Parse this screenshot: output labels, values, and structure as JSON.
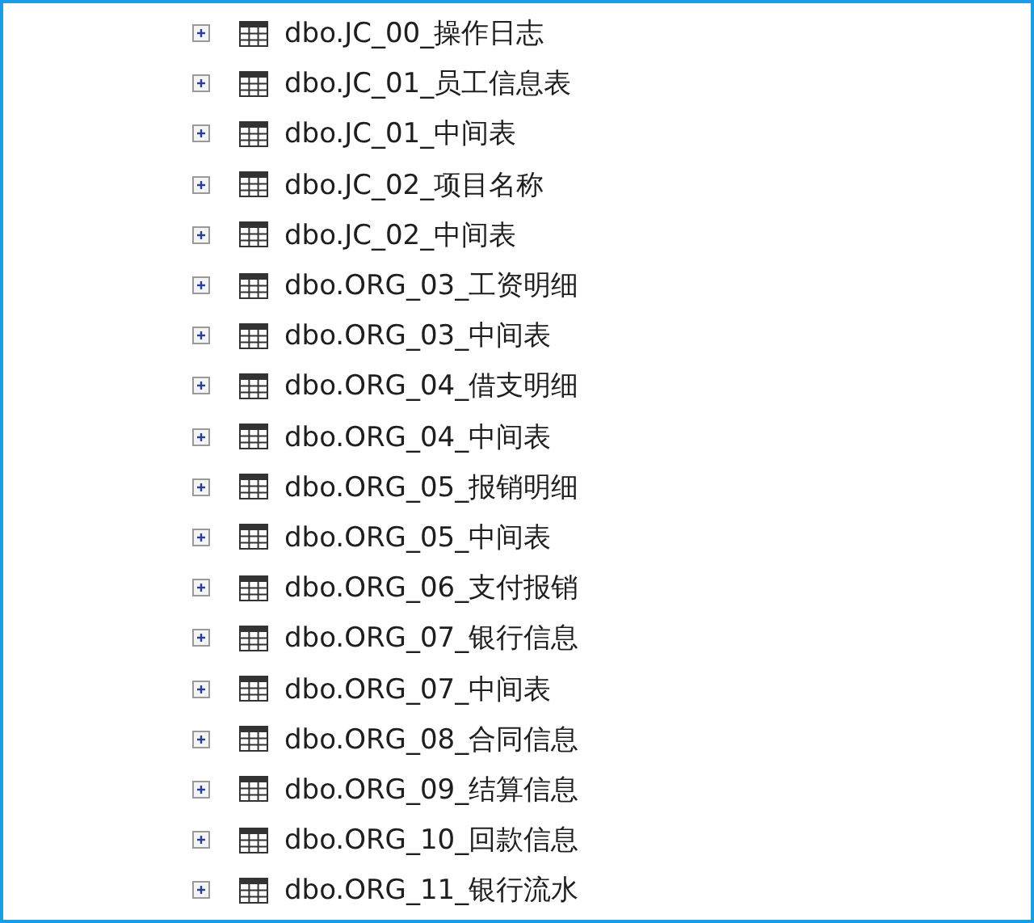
{
  "tree": {
    "items": [
      {
        "label": "dbo.JC_00_操作日志",
        "expanded": false
      },
      {
        "label": "dbo.JC_01_员工信息表",
        "expanded": false
      },
      {
        "label": "dbo.JC_01_中间表",
        "expanded": false
      },
      {
        "label": "dbo.JC_02_项目名称",
        "expanded": false
      },
      {
        "label": "dbo.JC_02_中间表",
        "expanded": false
      },
      {
        "label": "dbo.ORG_03_工资明细",
        "expanded": false
      },
      {
        "label": "dbo.ORG_03_中间表",
        "expanded": false
      },
      {
        "label": "dbo.ORG_04_借支明细",
        "expanded": false
      },
      {
        "label": "dbo.ORG_04_中间表",
        "expanded": false
      },
      {
        "label": "dbo.ORG_05_报销明细",
        "expanded": false
      },
      {
        "label": "dbo.ORG_05_中间表",
        "expanded": false
      },
      {
        "label": "dbo.ORG_06_支付报销",
        "expanded": false
      },
      {
        "label": "dbo.ORG_07_银行信息",
        "expanded": false
      },
      {
        "label": "dbo.ORG_07_中间表",
        "expanded": false
      },
      {
        "label": "dbo.ORG_08_合同信息",
        "expanded": false
      },
      {
        "label": "dbo.ORG_09_结算信息",
        "expanded": false
      },
      {
        "label": "dbo.ORG_10_回款信息",
        "expanded": false
      },
      {
        "label": "dbo.ORG_11_银行流水",
        "expanded": false
      }
    ]
  }
}
